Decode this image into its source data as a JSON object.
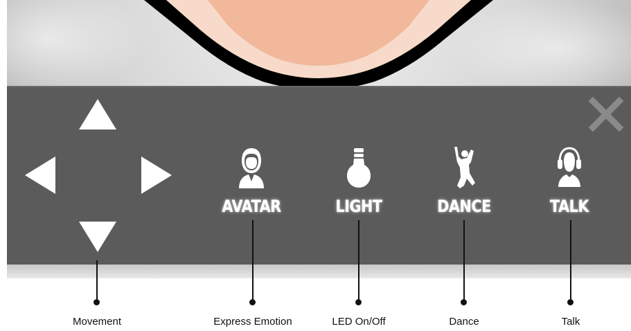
{
  "close_button": {
    "icon": "close-icon",
    "color": "#8a8a8a"
  },
  "movement_pad": {
    "up_icon": "arrow-up-icon",
    "down_icon": "arrow-down-icon",
    "left_icon": "arrow-left-icon",
    "right_icon": "arrow-right-icon"
  },
  "actions": [
    {
      "label": "AVATAR",
      "icon": "avatar-icon"
    },
    {
      "label": "LIGHT",
      "icon": "light-bulb-icon"
    },
    {
      "label": "DANCE",
      "icon": "dancer-icon"
    },
    {
      "label": "TALK",
      "icon": "headset-icon"
    }
  ],
  "callouts": [
    {
      "text": "Movement"
    },
    {
      "text": "Express Emotion"
    },
    {
      "text": "LED On/Off"
    },
    {
      "text": "Dance"
    },
    {
      "text": "Talk"
    }
  ],
  "colors": {
    "panel": "#5b5b5b",
    "icon": "#ffffff",
    "face_skin": "#f3c4a5",
    "face_outline": "#000000"
  }
}
